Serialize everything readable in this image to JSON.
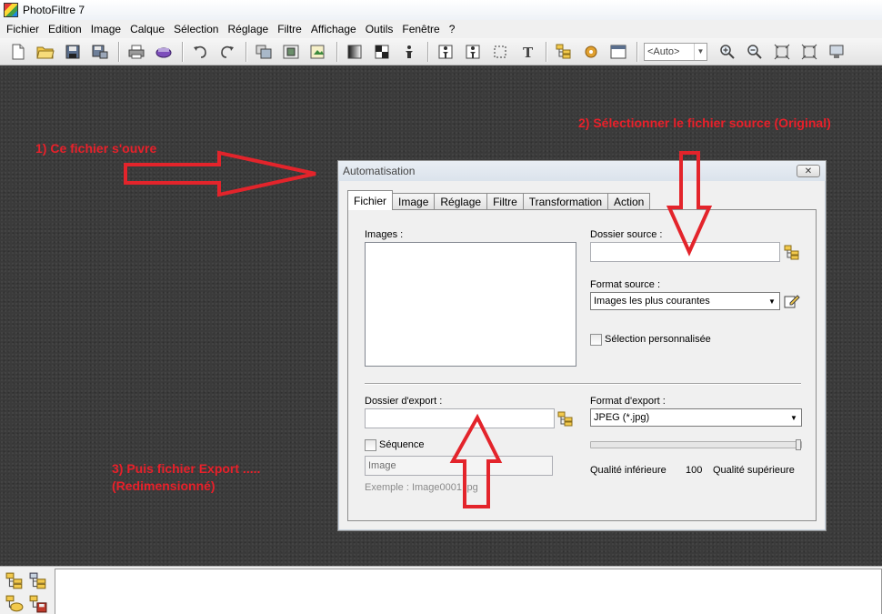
{
  "window": {
    "title": "PhotoFiltre 7"
  },
  "menu": [
    "Fichier",
    "Edition",
    "Image",
    "Calque",
    "Sélection",
    "Réglage",
    "Filtre",
    "Affichage",
    "Outils",
    "Fenêtre",
    "?"
  ],
  "toolbar": {
    "zoom_value": "<Auto>"
  },
  "annotations": {
    "step1": "1) Ce fichier s'ouvre",
    "step2": "2) Sélectionner le fichier source  (Original)",
    "step3_line1": "3) Puis fichier Export .....",
    "step3_line2": "(Redimensionné)"
  },
  "dialog": {
    "title": "Automatisation",
    "close_label": "✕",
    "tabs": [
      "Fichier",
      "Image",
      "Réglage",
      "Filtre",
      "Transformation",
      "Action"
    ],
    "active_tab": "Fichier",
    "images_label": "Images :",
    "source_folder_label": "Dossier source :",
    "source_folder_value": "",
    "source_format_label": "Format source :",
    "source_format_value": "Images les plus courantes",
    "custom_selection_label": "Sélection personnalisée",
    "export_folder_label": "Dossier d'export :",
    "export_folder_value": "",
    "sequence_label": "Séquence",
    "sequence_name_value": "Image",
    "example_text": "Exemple : Image0001.jpg",
    "export_format_label": "Format d'export :",
    "export_format_value": "JPEG (*.jpg)",
    "quality_low_label": "Qualité inférieure",
    "quality_value": "100",
    "quality_high_label": "Qualité supérieure"
  },
  "colors": {
    "annotation": "#e8202a",
    "workspace": "#3b3b3b"
  }
}
